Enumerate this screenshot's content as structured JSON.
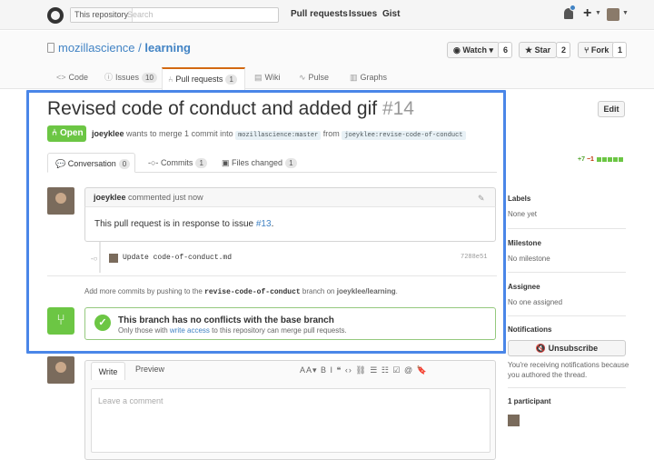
{
  "header": {
    "search_scope": "This repository",
    "search_placeholder": "Search",
    "links": [
      "Pull requests",
      "Issues",
      "Gist"
    ]
  },
  "repo": {
    "owner": "mozillascience",
    "separator": " / ",
    "name": "learning",
    "watch_label": "Watch",
    "watch_count": "6",
    "star_label": "Star",
    "star_count": "2",
    "fork_label": "Fork",
    "fork_count": "1",
    "tabs": [
      {
        "label": "Code",
        "icon": "code-icon",
        "count": ""
      },
      {
        "label": "Issues",
        "icon": "issue-icon",
        "count": "10"
      },
      {
        "label": "Pull requests",
        "icon": "pull-request-icon",
        "count": "1"
      },
      {
        "label": "Wiki",
        "icon": "wiki-icon",
        "count": ""
      },
      {
        "label": "Pulse",
        "icon": "pulse-icon",
        "count": ""
      },
      {
        "label": "Graphs",
        "icon": "graph-icon",
        "count": ""
      }
    ]
  },
  "pr": {
    "title": "Revised code of conduct and added gif",
    "number": "#14",
    "edit_label": "Edit",
    "state": "Open",
    "author": "joeyklee",
    "meta_text": " wants to merge 1 commit into ",
    "base_branch": "mozillascience:master",
    "from_text": " from ",
    "head_branch": "joeyklee:revise-code-of-conduct",
    "tabs": [
      {
        "label": "Conversation",
        "count": "0"
      },
      {
        "label": "Commits",
        "count": "1"
      },
      {
        "label": "Files changed",
        "count": "1"
      }
    ],
    "additions": "+7",
    "deletions": "−1"
  },
  "comment": {
    "author": "joeyklee",
    "meta": " commented just now",
    "body_text": "This pull request is in response to issue ",
    "body_link": "#13",
    "body_end": "."
  },
  "commit": {
    "message": "Update code-of-conduct.md",
    "sha": "7288e51"
  },
  "more_commits": {
    "prefix": "Add more commits by pushing to the ",
    "branch": "revise-code-of-conduct",
    "middle": " branch on ",
    "repo": "joeyklee/learning",
    "end": "."
  },
  "merge": {
    "title": "This branch has no conflicts with the base branch",
    "sub_prefix": "Only those with ",
    "sub_link": "write access",
    "sub_suffix": " to this repository can merge pull requests."
  },
  "form": {
    "write_tab": "Write",
    "preview_tab": "Preview",
    "toolbar": "AA▾  B  I     ❝  ‹›  ⛓     ☰  ☷  ☑     @  🔖",
    "placeholder": "Leave a comment"
  },
  "sidebar": {
    "labels_title": "Labels",
    "labels_value": "None yet",
    "milestone_title": "Milestone",
    "milestone_value": "No milestone",
    "assignee_title": "Assignee",
    "assignee_value": "No one assigned",
    "notifications_title": "Notifications",
    "unsubscribe_label": "Unsubscribe",
    "notifications_note": "You're receiving notifications because you authored the thread.",
    "participants_title": "1 participant"
  },
  "colors": {
    "accent": "#4183c4",
    "open_green": "#6cc644",
    "highlight_blue": "#4a86e8",
    "tab_orange": "#d26911"
  }
}
